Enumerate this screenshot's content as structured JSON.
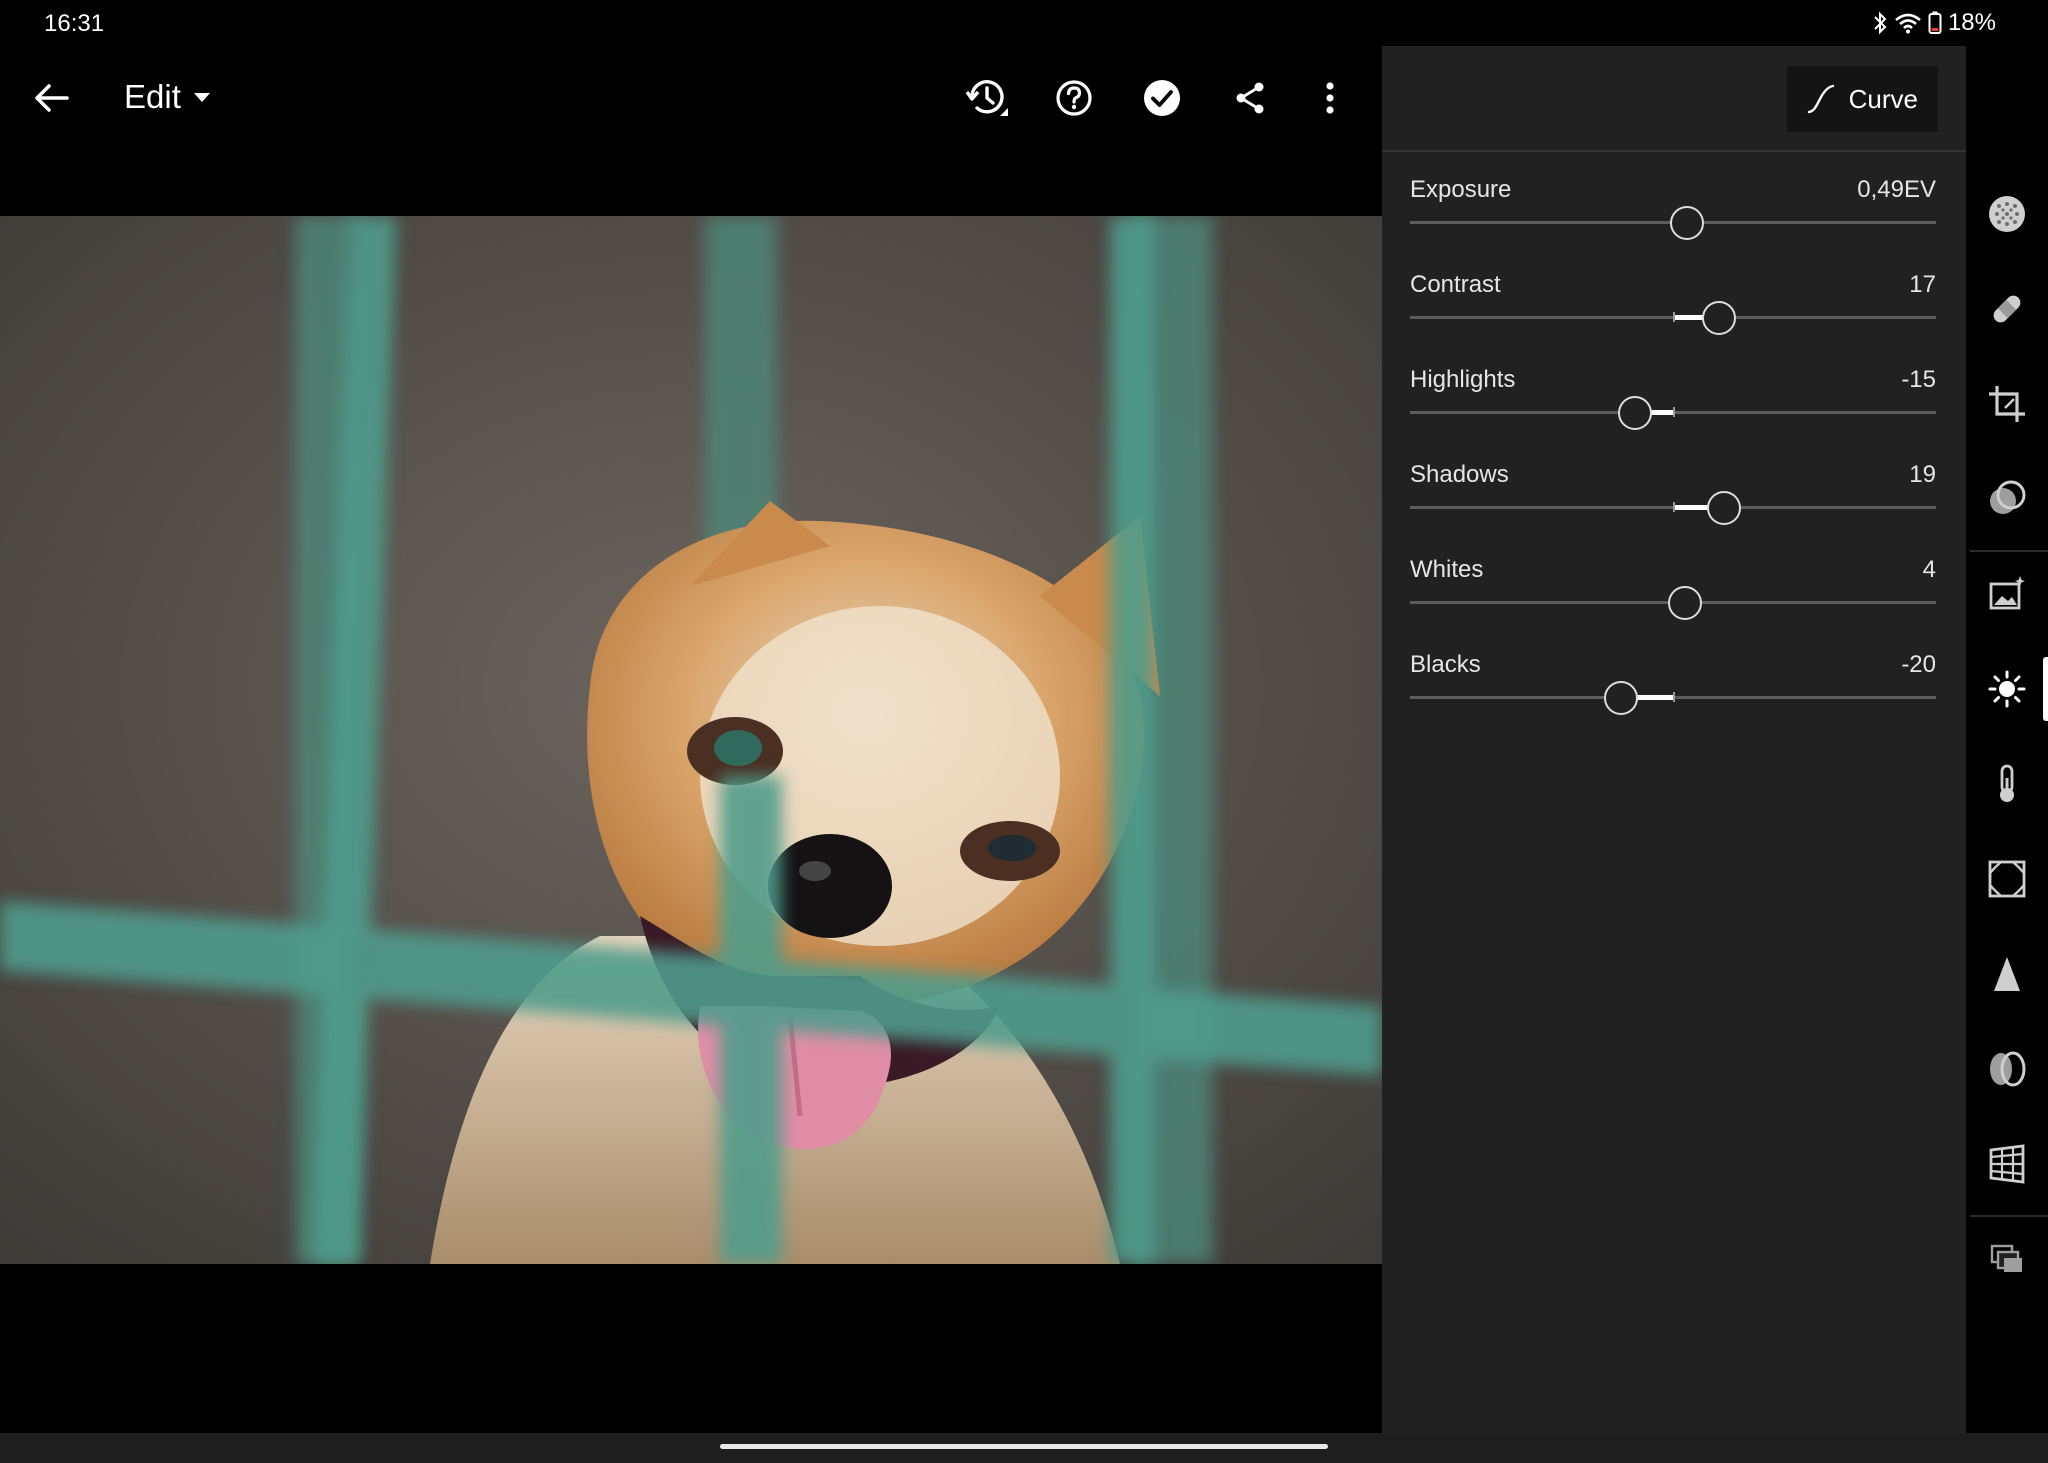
{
  "status_bar": {
    "time": "16:31",
    "battery": "18%",
    "icons": [
      "bluetooth-icon",
      "wifi-icon",
      "battery-icon"
    ]
  },
  "toolbar": {
    "title": "Edit",
    "icons": [
      "back-arrow-icon",
      "caret-down-icon",
      "history-icon",
      "help-icon",
      "checkmark-icon",
      "share-icon",
      "more-vert-icon"
    ]
  },
  "panel": {
    "curve_label": "Curve",
    "sliders": [
      {
        "label": "Exposure",
        "value": "0,49EV",
        "level": 0.049
      },
      {
        "label": "Contrast",
        "value": "17",
        "level": 0.17
      },
      {
        "label": "Highlights",
        "value": "-15",
        "level": -0.15
      },
      {
        "label": "Shadows",
        "value": "19",
        "level": 0.19
      },
      {
        "label": "Whites",
        "value": "4",
        "level": 0.04
      },
      {
        "label": "Blacks",
        "value": "-20",
        "level": -0.2
      }
    ]
  },
  "tool_rail": {
    "items": [
      "presets-icon",
      "healing-icon",
      "crop-icon",
      "masking-icon",
      "auto-icon",
      "light-icon",
      "color-icon",
      "effects-icon",
      "detail-icon",
      "optics-icon",
      "geometry-icon",
      "versions-icon"
    ],
    "active": "light-icon"
  },
  "colors": {
    "panel_bg": "#212121",
    "app_bg": "#000000",
    "accent": "#ffffff"
  }
}
